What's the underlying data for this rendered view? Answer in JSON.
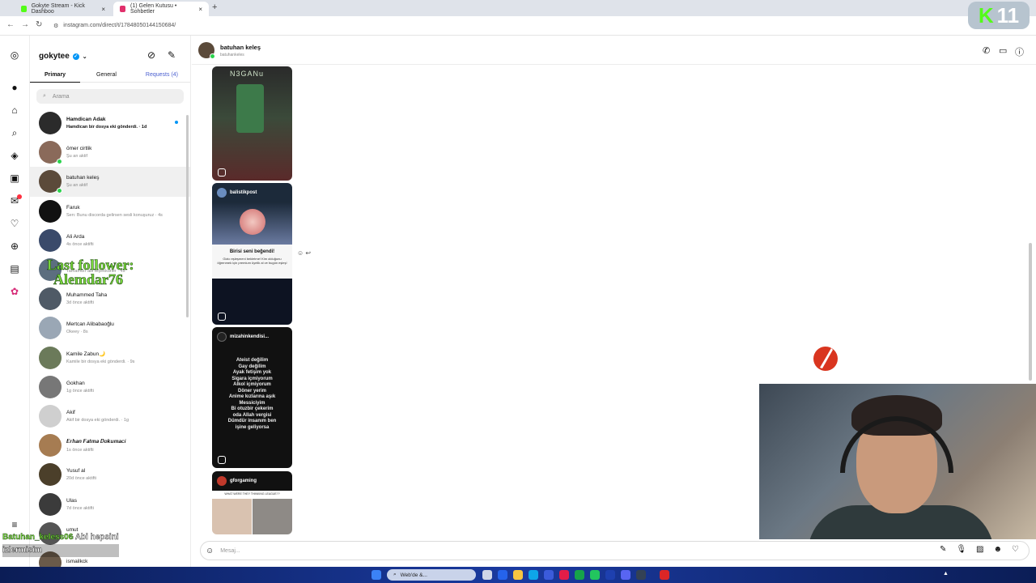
{
  "browser": {
    "tabs": [
      {
        "title": "Gokyte Stream - Kick Dashboo",
        "close": "×"
      },
      {
        "title": "(1) Gelen Kutusu • Sohbetler",
        "close": "×"
      }
    ],
    "new_tab": "+",
    "url": "instagram.com/direct/t/17848050144150684/",
    "kick_badge": {
      "k": "K",
      "number": "11"
    }
  },
  "inbox": {
    "username": "gokytee",
    "tabs": {
      "primary": "Primary",
      "general": "General",
      "requests": "Requests (4)"
    },
    "search_placeholder": "Arama",
    "conversations": [
      {
        "name": "Hamdican Adak",
        "preview": "Hamdican bir dosya eki gönderdi. · 1d",
        "unread": true,
        "color": "#2b2b2b"
      },
      {
        "name": "ömer cirtlik",
        "preview": "Şu an aktif",
        "online": true,
        "color": "#8a6a5a"
      },
      {
        "name": "batuhan keleş",
        "preview": "Şu an aktif",
        "online": true,
        "active": true,
        "color": "#5b4a3a"
      },
      {
        "name": "Faruk",
        "preview": "Sen: Bunu discorda gelirsen sesli konuşuruz · 4s",
        "color": "#111111"
      },
      {
        "name": "Ali Arda",
        "preview": "4s önce aktifti",
        "color": "#3a4a6a"
      },
      {
        "name": "",
        "preview": "Tamamdır abi teşekkürler · 4s",
        "color": "#5c6e7f"
      },
      {
        "name": "Muhammed Taha",
        "preview": "3d önce aktifti",
        "color": "#4f5a66"
      },
      {
        "name": "Mertcan Alibabaoğlu",
        "preview": "Okeey · 8s",
        "color": "#9aa7b5"
      },
      {
        "name": "Kamile Zabun🌙",
        "preview": "Kamile bir dosya eki gönderdi. · 9s",
        "color": "#6b7a5a"
      },
      {
        "name": "Gokhan",
        "preview": "1g önce aktifti",
        "color": "#777777"
      },
      {
        "name": "Akif",
        "preview": "Akif bir dosya eki gönderdi. · 1g",
        "color": "#cfcfcf"
      },
      {
        "name": "𝑬𝒓𝒉𝒂𝒏 𝑭𝒂𝒕𝒎𝒂 𝑫𝒐𝒌𝒖𝒎𝒂𝒄𝒊",
        "preview": "1s önce aktifti",
        "color": "#a67c52"
      },
      {
        "name": "Yusuf al",
        "preview": "20d önce aktifti",
        "color": "#4b3f2a"
      },
      {
        "name": "Ulas",
        "preview": "7d önce aktifti",
        "color": "#3b3b3b"
      },
      {
        "name": "umut",
        "preview": "· 2g",
        "color": "#555555"
      },
      {
        "name": "ismailkck",
        "preview": "",
        "color": "#6a5a4a"
      }
    ]
  },
  "chat": {
    "name": "batuhan keleş",
    "username": "batuhankeles",
    "posts": [
      {
        "account": "",
        "caption": "N3GANu"
      },
      {
        "account": "balistikpost",
        "caption": "Birisi seni beğendi!",
        "subcaption": "Gizio eşleşmeni bekletme! Kim olduğunu öğrenmek için premium üyelik al ve bugün eşleş!"
      },
      {
        "account": "mizahinkendisi...",
        "caption": "Ateist değilim\nGay değilim\nAyak fetişim yok\nSigara içmiyorum\nAlkol içmiyorum\nDöner yerim\nAnime kızlarına aşık\nMessiciyim\nBi otuzbir çekerim\noda Allah vergisi\nDümdür insanım ben\nişine geliyorsa"
      },
      {
        "account": "gforgaming",
        "caption": "WHAT WERE THEY THINKING LEAGUE??"
      }
    ],
    "composer_placeholder": "Mesaj..."
  },
  "overlays": {
    "last_follower_title": "Last follower:",
    "last_follower_name": "Alemdar76",
    "chat_user": "Batuhan_keless06",
    "chat_message_1": "Abi hepsini",
    "chat_message_2": "izlermisim"
  },
  "taskbar": {
    "search_label": "Web'de &..."
  },
  "colors": {
    "accent": "#0095f6",
    "online": "#2bd34d",
    "kick_green": "#53fc18",
    "overlay_green": "#7bdc3c"
  }
}
